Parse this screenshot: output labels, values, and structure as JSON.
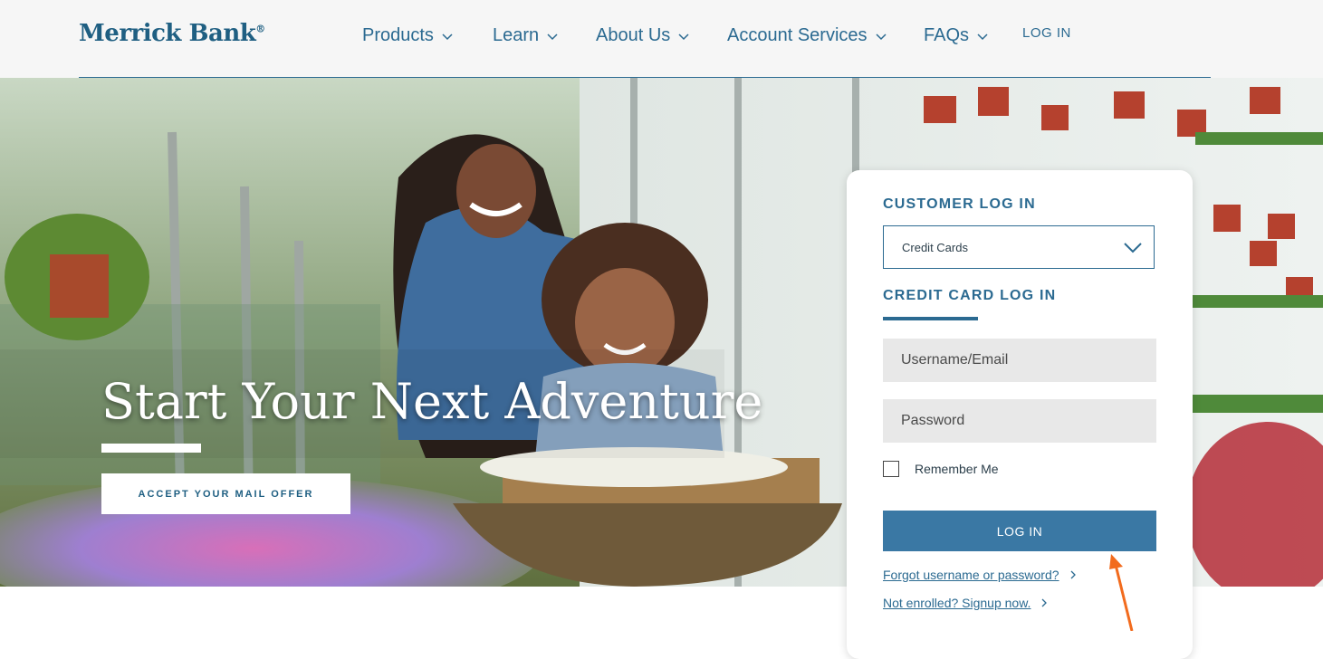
{
  "brand": {
    "name": "Merrick Bank",
    "mark": "®"
  },
  "nav": {
    "items": [
      {
        "label": "Products"
      },
      {
        "label": "Learn"
      },
      {
        "label": "About Us"
      },
      {
        "label": "Account Services"
      },
      {
        "label": "FAQs"
      }
    ],
    "login_label": "LOG IN"
  },
  "hero": {
    "headline": "Start Your Next Adventure",
    "cta_label": "ACCEPT YOUR MAIL OFFER"
  },
  "login_card": {
    "title": "CUSTOMER LOG IN",
    "account_type": {
      "selected": "Credit Cards"
    },
    "section_title": "CREDIT CARD LOG IN",
    "username": {
      "placeholder": "Username/Email",
      "value": ""
    },
    "password": {
      "placeholder": "Password",
      "value": ""
    },
    "remember_label": "Remember Me",
    "remember_checked": false,
    "submit_label": "LOG IN",
    "forgot_link": "Forgot username or password?",
    "enroll_link": "Not enrolled? Signup now."
  },
  "colors": {
    "brand_blue": "#1f5f82",
    "nav_blue": "#2b6a91",
    "button_blue": "#3a78a4",
    "annotation_arrow": "#f26b1d"
  },
  "icons": [
    "chevron-down-icon",
    "chevron-right-icon",
    "arrow-annotation-icon"
  ]
}
